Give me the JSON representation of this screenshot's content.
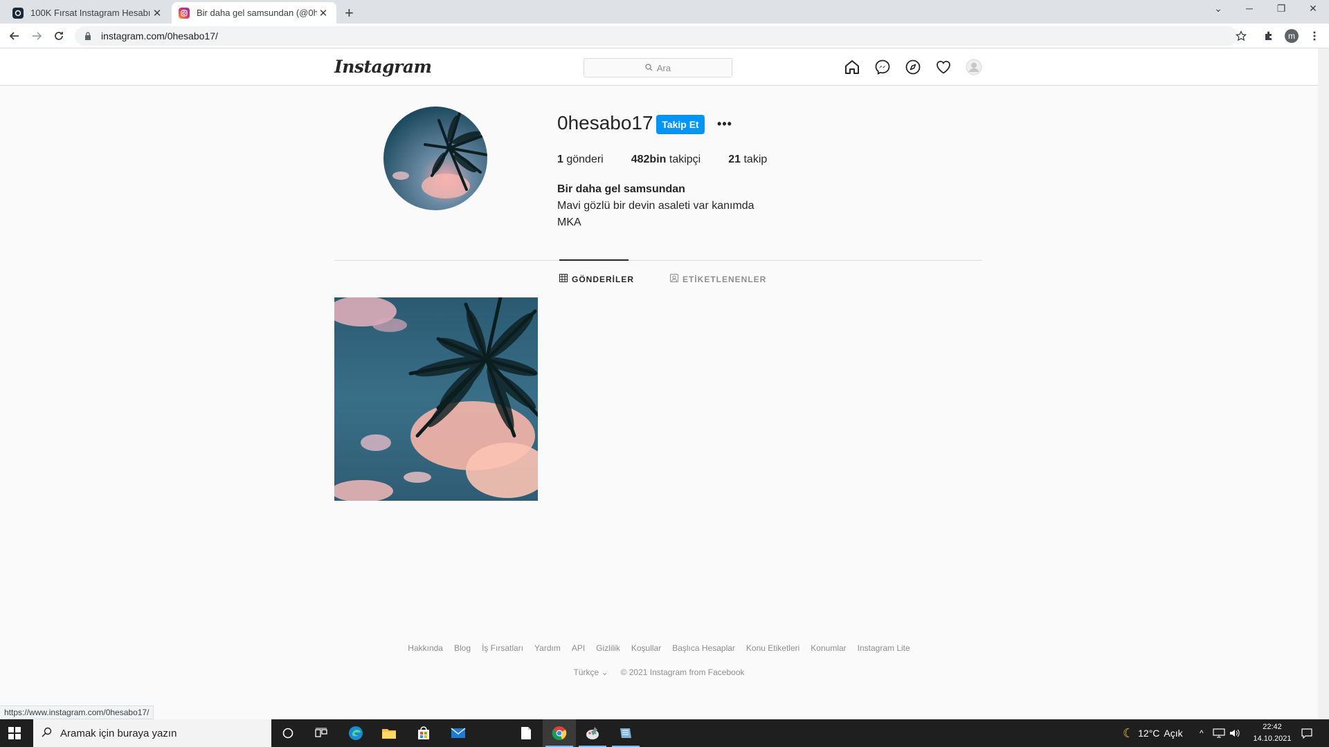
{
  "browser": {
    "tabs": [
      {
        "title": "100K Fırsat Instagram Hesabı | İt",
        "active": false
      },
      {
        "title": "Bir daha gel samsundan (@0hesa",
        "active": true
      }
    ],
    "new_tab": "+",
    "url": "instagram.com/0hesabo17/",
    "profile_initial": "m",
    "status_url": "https://www.instagram.com/0hesabo17/"
  },
  "instagram": {
    "logo": "Instagram",
    "search_placeholder": "Ara",
    "profile": {
      "username": "0hesabo17",
      "follow_label": "Takip Et",
      "more_label": "•••",
      "stats": {
        "posts_count": "1",
        "posts_label": "gönderi",
        "followers_count": "482bin",
        "followers_label": "takipçi",
        "following_count": "21",
        "following_label": "takip"
      },
      "bio_name": "Bir daha gel samsundan",
      "bio_line1": "Mavi gözlü bir devin asaleti var kanımda",
      "bio_line2": "MKA"
    },
    "tabs": {
      "posts": "GÖNDERİLER",
      "tagged": "ETİKETLENENLER"
    },
    "footer": {
      "links": [
        "Hakkında",
        "Blog",
        "İş Fırsatları",
        "Yardım",
        "API",
        "Gizlilik",
        "Koşullar",
        "Başlıca Hesaplar",
        "Konu Etiketleri",
        "Konumlar",
        "Instagram Lite"
      ],
      "language": "Türkçe",
      "copyright": "© 2021 Instagram from Facebook"
    }
  },
  "taskbar": {
    "search_placeholder": "Aramak için buraya yazın",
    "weather_temp": "12°C",
    "weather_text": "Açık",
    "time": "22:42",
    "date": "14.10.2021"
  },
  "colors": {
    "follow_blue": "#0095f6",
    "taskbar": "#1f1f1f"
  }
}
